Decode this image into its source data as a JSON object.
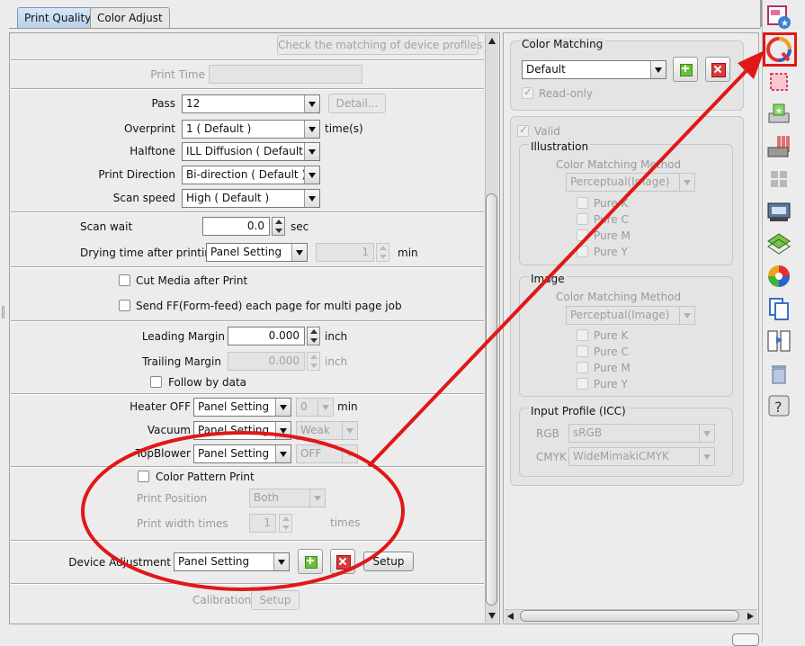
{
  "tabs": {
    "print_quality": "Print Quality",
    "color_adjust": "Color Adjust"
  },
  "left": {
    "check_profiles": "Check the matching of device profiles",
    "print_time": "Print Time",
    "pass": {
      "label": "Pass",
      "value": "12",
      "detail": "Detail..."
    },
    "overprint": {
      "label": "Overprint",
      "value": "1 ( Default )",
      "unit": "time(s)"
    },
    "halftone": {
      "label": "Halftone",
      "value": "ILL Diffusion ( Default )"
    },
    "print_direction": {
      "label": "Print Direction",
      "value": "Bi-direction ( Default )"
    },
    "scan_speed": {
      "label": "Scan speed",
      "value": "High ( Default )"
    },
    "scan_wait": {
      "label": "Scan wait",
      "value": "0.0",
      "unit": "sec"
    },
    "drying_time": {
      "label": "Drying time after printing",
      "value": "Panel Setting",
      "num": "1",
      "unit": "min"
    },
    "cut_media": "Cut Media after Print",
    "send_ff": "Send FF(Form-feed) each page for multi page job",
    "leading_margin": {
      "label": "Leading Margin",
      "value": "0.000",
      "unit": "inch"
    },
    "trailing_margin": {
      "label": "Trailing Margin",
      "value": "0.000",
      "unit": "inch"
    },
    "follow_by_data": "Follow by data",
    "heater_off": {
      "label": "Heater OFF",
      "value": "Panel Setting",
      "num": "0",
      "unit": "min"
    },
    "vacuum": {
      "label": "Vacuum",
      "value": "Panel Setting",
      "level": "Weak"
    },
    "topblower": {
      "label": "TopBlower",
      "value": "Panel Setting",
      "level": "OFF"
    },
    "color_pattern": "Color Pattern Print",
    "print_position": {
      "label": "Print Position",
      "value": "Both"
    },
    "print_width": {
      "label": "Print width times",
      "value": "1",
      "unit": "times"
    },
    "device_adjustment": {
      "label": "Device Adjustment",
      "value": "Panel Setting",
      "setup": "Setup"
    },
    "calibration": {
      "label": "Calibration",
      "setup": "Setup"
    }
  },
  "right": {
    "color_matching": {
      "title": "Color Matching",
      "value": "Default",
      "readonly": "Read-only"
    },
    "valid": "Valid",
    "illustration": {
      "title": "Illustration",
      "method_label": "Color Matching Method",
      "method": "Perceptual(Image)",
      "k": "Pure K",
      "c": "Pure C",
      "m": "Pure M",
      "y": "Pure Y"
    },
    "image": {
      "title": "Image",
      "method_label": "Color Matching Method",
      "method": "Perceptual(Image)",
      "k": "Pure K",
      "c": "Pure C",
      "m": "Pure M",
      "y": "Pure Y"
    },
    "input_profile": {
      "title": "Input Profile (ICC)",
      "rgb_label": "RGB",
      "rgb": "sRGB",
      "cmyk_label": "CMYK",
      "cmyk": "WideMimakiCMYK"
    }
  },
  "colors": {
    "annotation": "#e01818",
    "accent": "#6abf3a",
    "delete": "#d93a3a"
  }
}
